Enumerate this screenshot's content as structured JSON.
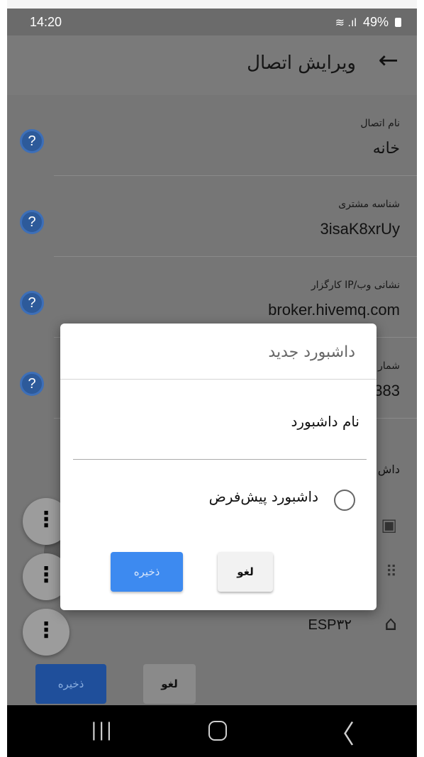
{
  "status_bar": {
    "time": "14:20",
    "signal": "ḯ..ıl",
    "battery_percent": "49%"
  },
  "app_bar": {
    "title": "ویرایش اتصال",
    "back_icon": "←"
  },
  "fields": [
    {
      "label": "نام اتصال",
      "value": "خانه"
    },
    {
      "label": "شناسه مشتری",
      "value": "3isaK8xrUy"
    },
    {
      "label": "نشانی وب/IP کارگزار",
      "value": "broker.hivemq.com"
    },
    {
      "label": "شمار",
      "value": "383"
    }
  ],
  "help_icon": "?",
  "dashboards_section": {
    "title": "داش"
  },
  "device": {
    "label": "ESP۳۲"
  },
  "fab_icon": "⋮",
  "bottom_buttons": {
    "save": "ذخیره",
    "cancel": "لغو"
  },
  "dialog": {
    "title": "داشبورد جدید",
    "name_value": "نام داشبورد",
    "default_label": "داشبورد پیش‌فرض",
    "default_checked": false,
    "save_label": "ذخیره",
    "cancel_label": "لغو"
  },
  "nav_bar": {
    "recent": "|||",
    "back": "〈"
  },
  "colors": {
    "accent": "#3d8af0",
    "help_icon": "#2d5a9a"
  }
}
